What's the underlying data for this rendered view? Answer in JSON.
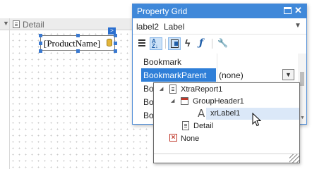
{
  "designer": {
    "band_label": "Detail",
    "control_text": "[ProductName]"
  },
  "property_grid": {
    "title": "Property Grid",
    "selected_component": {
      "name": "label2",
      "type": "Label"
    },
    "toolbar_icons": [
      "categorized-icon",
      "alphabetical-icon",
      "properties-icon",
      "events-icon",
      "expressions-icon",
      "settings-icon"
    ],
    "properties": [
      {
        "name": "Bookmark",
        "value": ""
      },
      {
        "name": "BookmarkParent",
        "value": "(none)",
        "selected": true
      },
      {
        "name": "Bo",
        "value": ""
      },
      {
        "name": "Bo",
        "value": ""
      },
      {
        "name": "Bo",
        "value": ""
      }
    ]
  },
  "tree_popup": {
    "nodes": [
      {
        "label": "XtraReport1",
        "icon": "report-icon",
        "level": 0,
        "expanded": true
      },
      {
        "label": "GroupHeader1",
        "icon": "group-header-icon",
        "level": 1,
        "expanded": true
      },
      {
        "label": "xrLabel1",
        "icon": "label-icon",
        "level": 2,
        "hover": true
      },
      {
        "label": "Detail",
        "icon": "detail-band-icon",
        "level": 1
      },
      {
        "label": "None",
        "icon": "none-icon",
        "level": 0
      }
    ]
  },
  "colors": {
    "title_bar": "#3f88d9",
    "selection": "#2f7fd8",
    "hover": "#dbe8f8"
  }
}
